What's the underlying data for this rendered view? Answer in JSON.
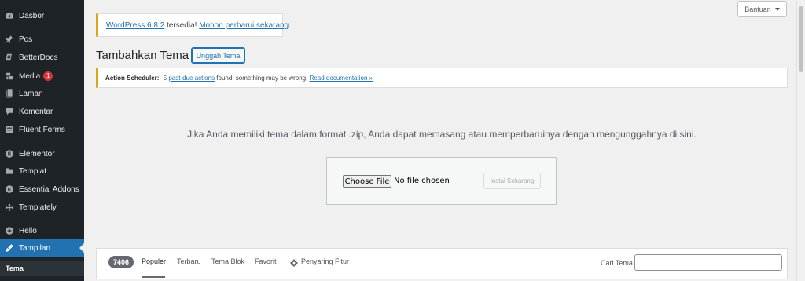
{
  "sidebar": {
    "items": [
      {
        "label": "Dasbor",
        "icon": "dashboard-icon"
      },
      {
        "label": "Pos",
        "icon": "pin-icon"
      },
      {
        "label": "BetterDocs",
        "icon": "docs-icon"
      },
      {
        "label": "Media",
        "icon": "media-icon",
        "badge": "1"
      },
      {
        "label": "Laman",
        "icon": "page-icon"
      },
      {
        "label": "Komentar",
        "icon": "comment-icon"
      },
      {
        "label": "Fluent Forms",
        "icon": "forms-icon"
      },
      {
        "label": "Elementor",
        "icon": "elementor-icon"
      },
      {
        "label": "Templat",
        "icon": "folder-icon"
      },
      {
        "label": "Essential Addons",
        "icon": "addons-icon"
      },
      {
        "label": "Templately",
        "icon": "templately-icon"
      },
      {
        "label": "Hello",
        "icon": "plus-circle-icon"
      },
      {
        "label": "Tampilan",
        "icon": "brush-icon",
        "active": true
      }
    ],
    "submenu_current": "Tema"
  },
  "help": {
    "label": "Bantuan"
  },
  "update_notice": {
    "link1": "WordPress 6.8.2",
    "text": " tersedia! ",
    "link2": "Mohon perbarui sekarang",
    "end": "."
  },
  "header": {
    "title": "Tambahkan Tema",
    "upload_label": "Unggah Tema"
  },
  "action_scheduler": {
    "label": "Action Scheduler:",
    "text1": " 5 ",
    "link1": "past-due actions",
    "text2": " found; something may be wrong. ",
    "link2": "Read documentation »"
  },
  "upload": {
    "description": "Jika Anda memiliki tema dalam format .zip, Anda dapat memasang atau memperbaruinya dengan mengunggahnya di sini.",
    "file_button": "Choose File",
    "file_status": "No file chosen",
    "install_label": "Instal Sekarang"
  },
  "filter": {
    "count": "7406",
    "tabs": [
      "Populer",
      "Terbaru",
      "Tema Blok",
      "Favorit"
    ],
    "feature_filter": "Penyaring Fitur",
    "search_label": "Cari Tema",
    "search_value": ""
  },
  "colors": {
    "accent": "#2271b1",
    "warning": "#dba617",
    "sidebar": "#1d2327",
    "badge": "#d63638"
  }
}
